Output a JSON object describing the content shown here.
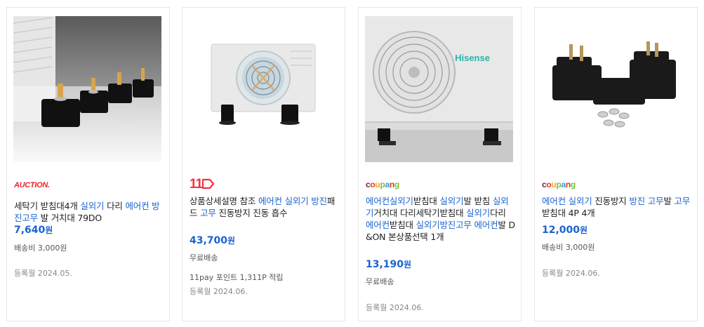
{
  "products": [
    {
      "mall": "AUCTION.",
      "title_parts": [
        {
          "t": "세탁기 받침대4개 ",
          "kw": false
        },
        {
          "t": "실외기",
          "kw": true
        },
        {
          "t": " 다리 ",
          "kw": false
        },
        {
          "t": "에어컨 방진고무",
          "kw": true
        },
        {
          "t": " 발 거치대 79DO",
          "kw": false
        }
      ],
      "price": "7,640",
      "price_unit": "원",
      "shipping": "배송비 3,000원",
      "extra": "",
      "date": "등록월 2024.05."
    },
    {
      "mall": "11",
      "title_parts": [
        {
          "t": "상품상세설명 참조 ",
          "kw": false
        },
        {
          "t": "에어컨 실외기 방진",
          "kw": true
        },
        {
          "t": "패드 ",
          "kw": false
        },
        {
          "t": "고무",
          "kw": true
        },
        {
          "t": " 진동방지 진동 흡수",
          "kw": false
        }
      ],
      "price": "43,700",
      "price_unit": "원",
      "shipping": "무료배송",
      "extra": "11pay 포인트 1,311P 적립",
      "date": "등록월 2024.06."
    },
    {
      "mall": "coupang",
      "title_parts": [
        {
          "t": "에어컨실외기",
          "kw": true
        },
        {
          "t": "받침대 ",
          "kw": false
        },
        {
          "t": "실외기",
          "kw": true
        },
        {
          "t": "발 받침 ",
          "kw": false
        },
        {
          "t": "실외기",
          "kw": true
        },
        {
          "t": "거치대 다리세탁기받침대 ",
          "kw": false
        },
        {
          "t": "실외기",
          "kw": true
        },
        {
          "t": "다리 ",
          "kw": false
        },
        {
          "t": "에어컨",
          "kw": true
        },
        {
          "t": "받침대 ",
          "kw": false
        },
        {
          "t": "실외기방진고무 에어컨",
          "kw": true
        },
        {
          "t": "발 D&ON 본상품선택 1개",
          "kw": false
        }
      ],
      "price": "13,190",
      "price_unit": "원",
      "shipping": "무료배송",
      "extra": "",
      "date": "등록월 2024.06."
    },
    {
      "mall": "coupang",
      "title_parts": [
        {
          "t": "에어컨 실외기",
          "kw": true
        },
        {
          "t": " 진동방지 ",
          "kw": false
        },
        {
          "t": "방진 고무",
          "kw": true
        },
        {
          "t": "발 ",
          "kw": false
        },
        {
          "t": "고무",
          "kw": true
        },
        {
          "t": " 받침대 4P 4개",
          "kw": false
        }
      ],
      "price": "12,000",
      "price_unit": "원",
      "shipping": "배송비 3,000원",
      "extra": "",
      "date": "등록월 2024.06."
    }
  ],
  "images": [
    {
      "icon": "product-image-mounts-on-unit"
    },
    {
      "icon": "product-image-ac-outdoor-unit"
    },
    {
      "icon": "product-image-hisense-unit"
    },
    {
      "icon": "product-image-rubber-feet"
    }
  ],
  "image_text": {
    "hisense_logo": "Hisense"
  },
  "colors": {
    "keyword": "#1a63d1",
    "price": "#1a63d1",
    "auction": "#e8262b",
    "eleven": "#f43142",
    "coupang_c": "#7a2a16",
    "coupang_o": "#e5352b",
    "coupang_u": "#f5a623",
    "coupang_p": "#77c041",
    "coupang_a": "#2ba0dc"
  }
}
